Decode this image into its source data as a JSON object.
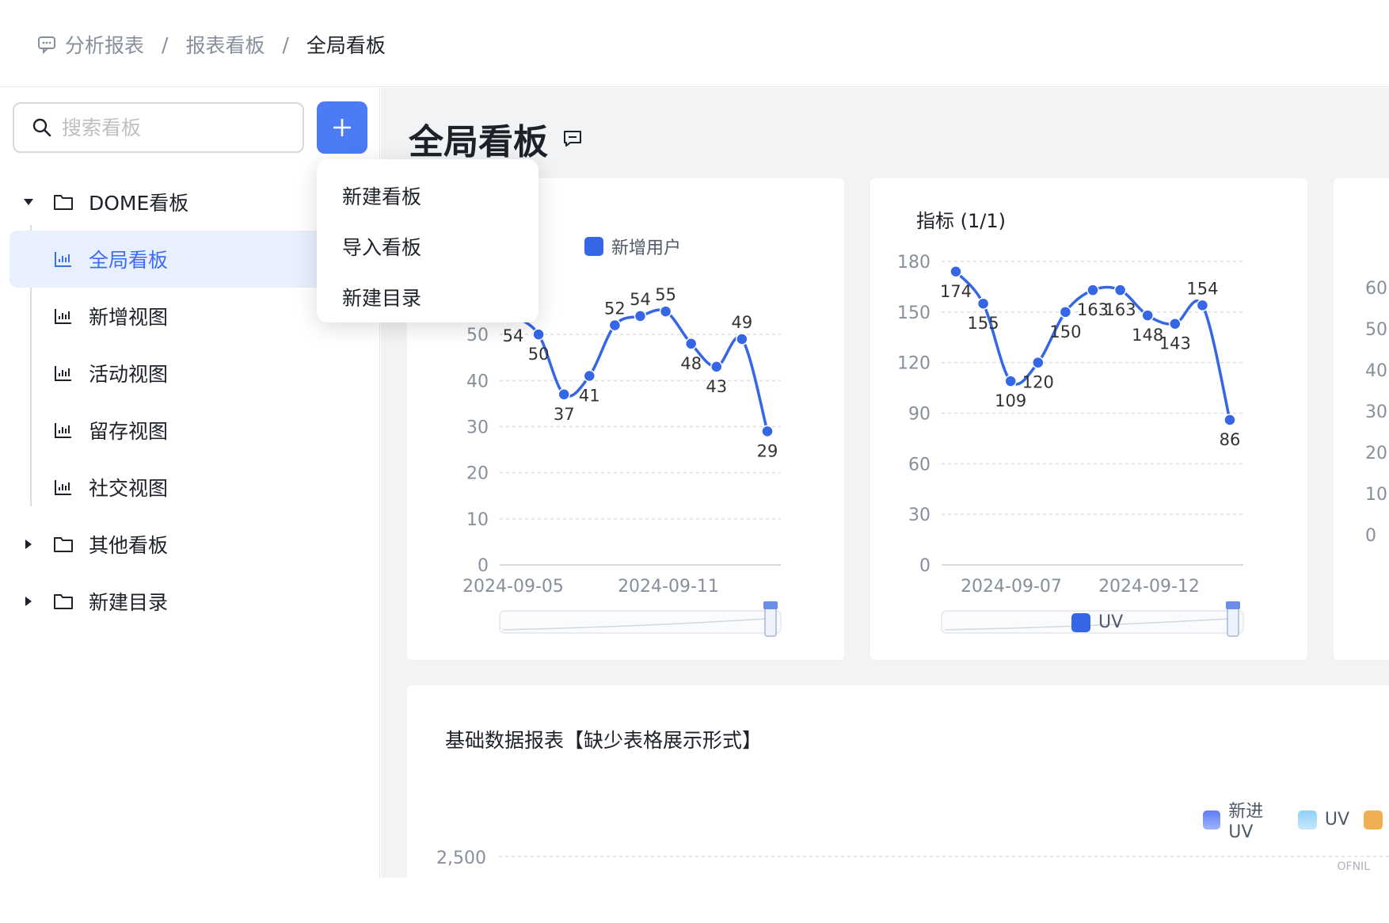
{
  "breadcrumb": {
    "items": [
      "分析报表",
      "报表看板",
      "全局看板"
    ]
  },
  "sidebar": {
    "search_placeholder": "搜索看板",
    "tree": [
      {
        "type": "folder",
        "label": "DOME看板",
        "expanded": true
      },
      {
        "type": "view",
        "label": "全局看板",
        "selected": true
      },
      {
        "type": "view",
        "label": "新增视图"
      },
      {
        "type": "view",
        "label": "活动视图"
      },
      {
        "type": "view",
        "label": "留存视图"
      },
      {
        "type": "view",
        "label": "社交视图"
      },
      {
        "type": "folder",
        "label": "其他看板",
        "expanded": false
      },
      {
        "type": "folder",
        "label": "新建目录",
        "expanded": false
      }
    ]
  },
  "dropdown": {
    "items": [
      "新建看板",
      "导入看板",
      "新建目录"
    ]
  },
  "page": {
    "title": "全局看板"
  },
  "colors": {
    "accent": "#3b6cf6",
    "line": "#3566e6"
  },
  "cards": [
    {
      "title": "",
      "legend": "新增用户"
    },
    {
      "title": "指标 (1/1)",
      "legend": "UV"
    },
    {
      "title": "基础数据报表【缺少表格展示形式】",
      "legend": [
        "新进UV",
        "UV"
      ]
    }
  ],
  "watermark": "OFNIL",
  "chart_data": [
    {
      "type": "line",
      "series": [
        {
          "name": "新增用户",
          "values": [
            54,
            50,
            37,
            41,
            52,
            54,
            55,
            48,
            43,
            49,
            29
          ]
        }
      ],
      "point_labels": [
        "54",
        "50",
        "37",
        "41",
        "52",
        "54",
        "55",
        "48",
        "43",
        "49",
        "29"
      ],
      "x_tick_labels": [
        "2024-09-05",
        "2024-09-11"
      ],
      "y_ticks": [
        0,
        10,
        20,
        30,
        40,
        50
      ],
      "y_tick_labels": [
        "0",
        "10",
        "20",
        "30",
        "40",
        "50"
      ],
      "ylim": [
        0,
        60
      ],
      "grid": true,
      "legend_position": "top"
    },
    {
      "type": "line",
      "series": [
        {
          "name": "UV",
          "values": [
            174,
            155,
            109,
            120,
            150,
            163,
            163,
            148,
            143,
            154,
            86
          ]
        }
      ],
      "point_labels": [
        "174",
        "155",
        "109",
        "120",
        "150",
        "163",
        "163",
        "148",
        "143",
        "154",
        "86"
      ],
      "x_tick_labels": [
        "2024-09-07",
        "2024-09-12"
      ],
      "y_ticks": [
        0,
        30,
        60,
        90,
        120,
        150,
        180
      ],
      "y_tick_labels": [
        "0",
        "30",
        "60",
        "90",
        "120",
        "150",
        "180"
      ],
      "ylim": [
        0,
        180
      ],
      "grid": true,
      "legend_position": "bottom"
    },
    {
      "type": "line",
      "y_tick_labels": [
        "60",
        "50",
        "40",
        "30",
        "20",
        "10",
        "0"
      ],
      "partial": true
    },
    {
      "type": "bar",
      "y_tick_labels": [
        "2,500"
      ],
      "legend": [
        "新进UV",
        "UV"
      ],
      "partial": true
    }
  ]
}
